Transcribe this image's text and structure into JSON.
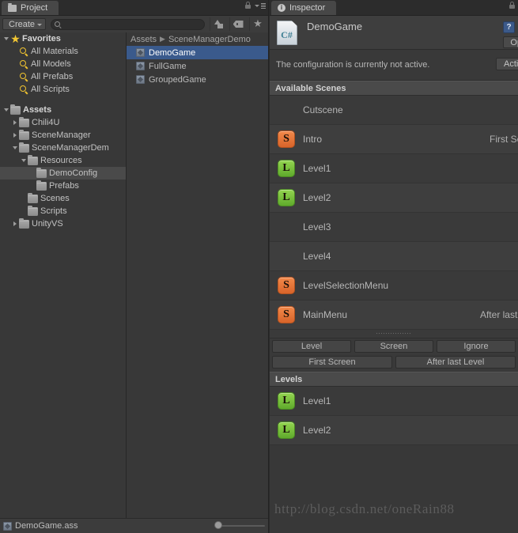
{
  "project_panel": {
    "tab_label": "Project",
    "tab_icon": "folder-icon",
    "lock_icon": "lock-icon",
    "menu_icon": "hamburger-menu-icon",
    "toolbar": {
      "create_label": "Create",
      "search_value": "",
      "search_placeholder": "",
      "search_icon": "search-icon",
      "filter_type_icon": "shapes-filter-icon",
      "filter_label_icon": "tag-icon",
      "filter_favorite_icon": "star-icon"
    },
    "tree": [
      {
        "label": "Favorites",
        "icon": "star-icon",
        "indent": 0,
        "twisty": "open",
        "bold": true,
        "selected": false
      },
      {
        "label": "All Materials",
        "icon": "magnifier-icon",
        "indent": 1,
        "twisty": "none",
        "bold": false,
        "selected": false
      },
      {
        "label": "All Models",
        "icon": "magnifier-icon",
        "indent": 1,
        "twisty": "none",
        "bold": false,
        "selected": false
      },
      {
        "label": "All Prefabs",
        "icon": "magnifier-icon",
        "indent": 1,
        "twisty": "none",
        "bold": false,
        "selected": false
      },
      {
        "label": "All Scripts",
        "icon": "magnifier-icon",
        "indent": 1,
        "twisty": "none",
        "bold": false,
        "selected": false
      },
      {
        "label": "",
        "icon": "none",
        "indent": 0,
        "twisty": "none",
        "bold": false,
        "selected": false
      },
      {
        "label": "Assets",
        "icon": "folder-icon",
        "indent": 0,
        "twisty": "open",
        "bold": true,
        "selected": false
      },
      {
        "label": "Chili4U",
        "icon": "folder-icon",
        "indent": 1,
        "twisty": "closed",
        "bold": false,
        "selected": false
      },
      {
        "label": "SceneManager",
        "icon": "folder-icon",
        "indent": 1,
        "twisty": "closed",
        "bold": false,
        "selected": false
      },
      {
        "label": "SceneManagerDem",
        "icon": "folder-icon",
        "indent": 1,
        "twisty": "open",
        "bold": false,
        "selected": false
      },
      {
        "label": "Resources",
        "icon": "folder-icon",
        "indent": 2,
        "twisty": "open",
        "bold": false,
        "selected": false
      },
      {
        "label": "DemoConfig",
        "icon": "folder-icon",
        "indent": 3,
        "twisty": "none",
        "bold": false,
        "selected": true
      },
      {
        "label": "Prefabs",
        "icon": "folder-icon",
        "indent": 3,
        "twisty": "none",
        "bold": false,
        "selected": false
      },
      {
        "label": "Scenes",
        "icon": "folder-icon",
        "indent": 2,
        "twisty": "none",
        "bold": false,
        "selected": false
      },
      {
        "label": "Scripts",
        "icon": "folder-icon",
        "indent": 2,
        "twisty": "none",
        "bold": false,
        "selected": false
      },
      {
        "label": "UnityVS",
        "icon": "folder-icon",
        "indent": 1,
        "twisty": "closed",
        "bold": false,
        "selected": false
      }
    ],
    "breadcrumb": {
      "root": "Assets",
      "separator": "▶",
      "current": "SceneManagerDemo"
    },
    "assets": [
      {
        "label": "DemoGame",
        "icon": "scriptable-object-icon",
        "selected": true
      },
      {
        "label": "FullGame",
        "icon": "scriptable-object-icon",
        "selected": false
      },
      {
        "label": "GroupedGame",
        "icon": "scriptable-object-icon",
        "selected": false
      }
    ],
    "status_bar": {
      "icon": "scriptable-object-icon",
      "label": "DemoGame.ass",
      "zoom_slider": "icon-size-slider"
    }
  },
  "inspector_panel": {
    "tab_label": "Inspector",
    "tab_icon": "info-icon",
    "lock_icon": "lock-icon",
    "title": "DemoGame",
    "asset_icon": "csharp-script-icon",
    "help_icon": "help-icon",
    "open_button": "Op",
    "notice_text": "The configuration is currently not active.",
    "activate_button": "Activa",
    "available_scenes": {
      "header": "Available Scenes",
      "rows": [
        {
          "name": "Cutscene",
          "badge": "none",
          "tag": ""
        },
        {
          "name": "Intro",
          "badge": "S",
          "tag": "First Scree"
        },
        {
          "name": "Level1",
          "badge": "L",
          "tag": ""
        },
        {
          "name": "Level2",
          "badge": "L",
          "tag": ""
        },
        {
          "name": "Level3",
          "badge": "none",
          "tag": ""
        },
        {
          "name": "Level4",
          "badge": "none",
          "tag": ""
        },
        {
          "name": "LevelSelectionMenu",
          "badge": "S",
          "tag": ""
        },
        {
          "name": "MainMenu",
          "badge": "S",
          "tag": "After last Lev"
        }
      ]
    },
    "grip": "resize-grip",
    "action_buttons_row1": [
      "Level",
      "Screen",
      "Ignore"
    ],
    "action_buttons_row2": [
      "First Screen",
      "After last Level"
    ],
    "levels": {
      "header": "Levels",
      "rows": [
        {
          "name": "Level1",
          "badge": "L"
        },
        {
          "name": "Level2",
          "badge": "L"
        }
      ]
    }
  },
  "watermark": "http://blog.csdn.net/oneRain88",
  "colors": {
    "panel_bg": "#383838",
    "header_bg": "#4a4a4a",
    "selection_blue": "#3a5a8c",
    "tree_selection": "#4a4a4a",
    "badge_screen_orange": "#e67733",
    "badge_level_green": "#6fb833",
    "text": "#b4b4b4"
  }
}
